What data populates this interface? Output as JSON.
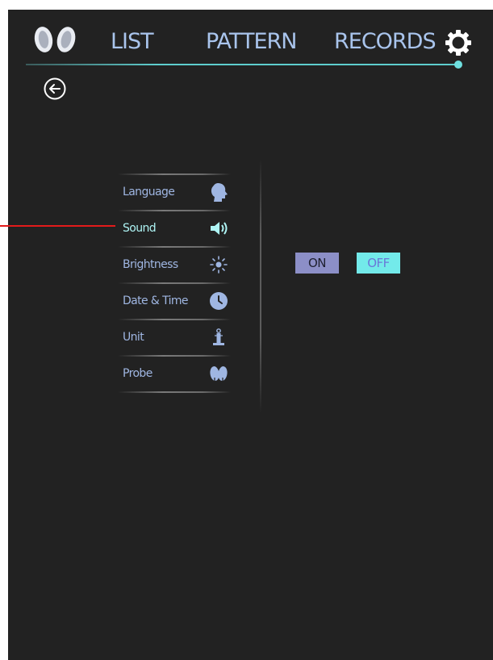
{
  "nav": {
    "tabs": [
      "LIST",
      "PATTERN",
      "RECORDS"
    ],
    "logo_icon": "probe-pair-icon",
    "settings_icon": "gear-icon",
    "back_icon": "back-arrow-icon"
  },
  "settings_menu": {
    "items": [
      {
        "label": "Language",
        "icon": "head-profile-icon"
      },
      {
        "label": "Sound",
        "icon": "speaker-icon"
      },
      {
        "label": "Brightness",
        "icon": "sun-icon"
      },
      {
        "label": "Date & Time",
        "icon": "clock-icon"
      },
      {
        "label": "Unit",
        "icon": "unit-icon"
      },
      {
        "label": "Probe",
        "icon": "probe-icon"
      }
    ],
    "selected": "Sound"
  },
  "sound_toggle": {
    "on_label": "ON",
    "off_label": "OFF",
    "selected": "OFF"
  },
  "colors": {
    "background": "#222222",
    "nav_text": "#a9c4ec",
    "accent_cyan": "#73eaea",
    "on_button": "#8c8fc7",
    "callout_line": "#e31b1b"
  }
}
